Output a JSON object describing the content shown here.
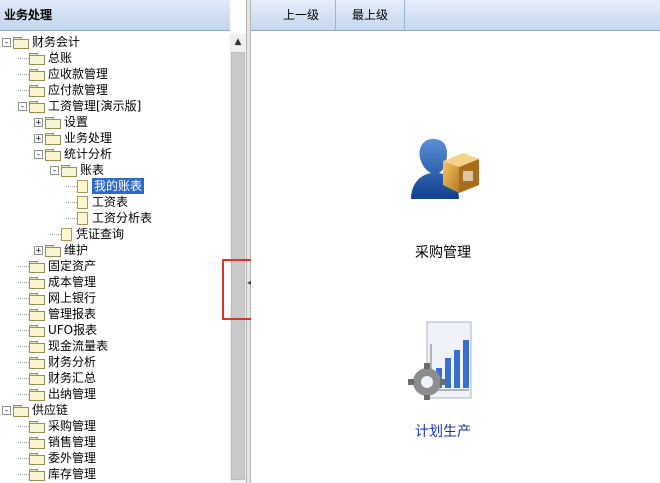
{
  "panel_title": "业务处理",
  "tree": [
    {
      "label": "财务会计",
      "level": 0,
      "exp": "-",
      "icon": "folder-icon"
    },
    {
      "label": "总账",
      "level": 1,
      "exp": "",
      "icon": "folder-icon"
    },
    {
      "label": "应收款管理",
      "level": 1,
      "exp": "",
      "icon": "folder-icon"
    },
    {
      "label": "应付款管理",
      "level": 1,
      "exp": "",
      "icon": "folder-icon"
    },
    {
      "label": "工资管理[演示版]",
      "level": 1,
      "exp": "-",
      "icon": "folder-icon"
    },
    {
      "label": "设置",
      "level": 2,
      "exp": "+",
      "icon": "folder-icon"
    },
    {
      "label": "业务处理",
      "level": 2,
      "exp": "+",
      "icon": "folder-icon"
    },
    {
      "label": "统计分析",
      "level": 2,
      "exp": "-",
      "icon": "folder-icon"
    },
    {
      "label": "账表",
      "level": 3,
      "exp": "-",
      "icon": "folder-icon"
    },
    {
      "label": "我的账表",
      "level": 4,
      "exp": "",
      "icon": "page-icon",
      "selected": true
    },
    {
      "label": "工资表",
      "level": 4,
      "exp": "",
      "icon": "page-icon"
    },
    {
      "label": "工资分析表",
      "level": 4,
      "exp": "",
      "icon": "page-icon"
    },
    {
      "label": "凭证查询",
      "level": 3,
      "exp": "",
      "icon": "page-icon"
    },
    {
      "label": "维护",
      "level": 2,
      "exp": "+",
      "icon": "folder-icon"
    },
    {
      "label": "固定资产",
      "level": 1,
      "exp": "",
      "icon": "folder-icon"
    },
    {
      "label": "成本管理",
      "level": 1,
      "exp": "",
      "icon": "folder-icon"
    },
    {
      "label": "网上银行",
      "level": 1,
      "exp": "",
      "icon": "folder-icon"
    },
    {
      "label": "管理报表",
      "level": 1,
      "exp": "",
      "icon": "folder-icon"
    },
    {
      "label": "UFO报表",
      "level": 1,
      "exp": "",
      "icon": "folder-icon"
    },
    {
      "label": "现金流量表",
      "level": 1,
      "exp": "",
      "icon": "folder-icon"
    },
    {
      "label": "财务分析",
      "level": 1,
      "exp": "",
      "icon": "folder-icon"
    },
    {
      "label": "财务汇总",
      "level": 1,
      "exp": "",
      "icon": "folder-icon"
    },
    {
      "label": "出纳管理",
      "level": 1,
      "exp": "",
      "icon": "folder-icon"
    },
    {
      "label": "供应链",
      "level": 0,
      "exp": "-",
      "icon": "folder-icon"
    },
    {
      "label": "采购管理",
      "level": 1,
      "exp": "",
      "icon": "folder-icon"
    },
    {
      "label": "销售管理",
      "level": 1,
      "exp": "",
      "icon": "folder-icon"
    },
    {
      "label": "委外管理",
      "level": 1,
      "exp": "",
      "icon": "folder-icon"
    },
    {
      "label": "库存管理",
      "level": 1,
      "exp": "",
      "icon": "folder-icon"
    }
  ],
  "toolbar": {
    "up_label": "上一级",
    "top_label": "最上级"
  },
  "apps": {
    "purchase": {
      "label": "采购管理",
      "icon": "purchase-person-box-icon",
      "color": "#000000"
    },
    "plan": {
      "label": "计划生产",
      "icon": "plan-chart-gear-icon",
      "color": "#1a33a6"
    }
  },
  "colors": {
    "selection": "#316ac5",
    "highlight_box": "#e03030"
  }
}
